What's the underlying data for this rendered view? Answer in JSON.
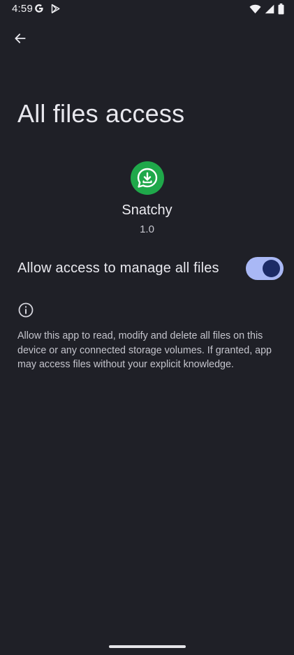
{
  "status_bar": {
    "time": "4:59",
    "left_icons": [
      "google-g-icon",
      "play-store-icon"
    ],
    "right_icons": [
      "wifi-icon",
      "signal-icon",
      "battery-icon"
    ]
  },
  "header": {
    "back_icon": "arrow-back-icon",
    "title": "All files access"
  },
  "app": {
    "icon": "download-icon",
    "icon_color": "#1fa84a",
    "name": "Snatchy",
    "version": "1.0"
  },
  "permission": {
    "label": "Allow access to manage all files",
    "enabled": true,
    "toggle_track_color": "#a9b8f5",
    "toggle_thumb_color": "#1c2b66"
  },
  "info": {
    "icon": "info-icon",
    "text": "Allow this app to read, modify and delete all files on this device or any connected storage volumes. If granted, app may access files without your explicit knowledge."
  },
  "colors": {
    "background": "#1f2027",
    "text_primary": "#e8e8ee",
    "text_secondary": "#c4c4cc"
  }
}
